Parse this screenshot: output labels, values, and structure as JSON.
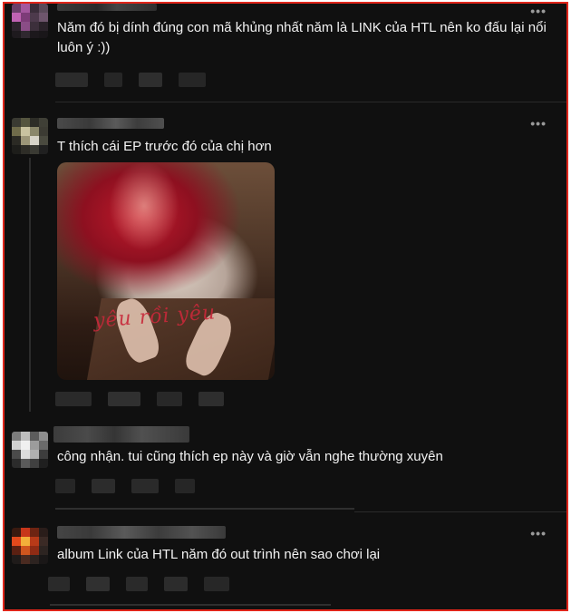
{
  "posts": [
    {
      "text": "Năm đó bị dính đúng con mã khủng nhất năm là LINK của HTL nên ko đấu lại nổi luôn ý :))",
      "more": "•••"
    },
    {
      "text": "T thích cái EP trước đó của chị hơn",
      "more": "•••",
      "image_caption": "yêu rồi yêu"
    },
    {
      "text": "công nhận. tui cũng thích ep này và giờ vẫn nghe thường xuyên",
      "more": ""
    },
    {
      "text": "album Link của HTL năm đó out trình nên sao chơi lại",
      "more": "•••"
    }
  ],
  "colors": {
    "frame_border": "#e0261b",
    "background": "#101010",
    "text": "#f2f2f2"
  }
}
